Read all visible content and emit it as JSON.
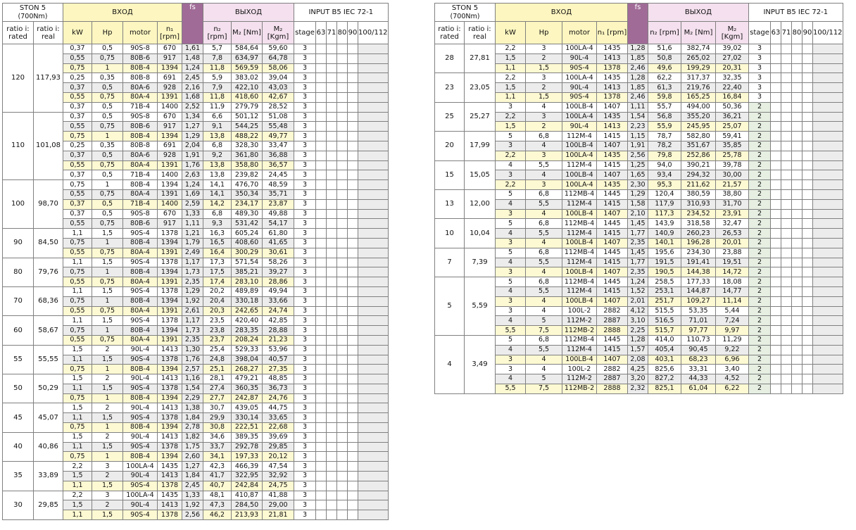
{
  "header": {
    "title": "STON 5",
    "torque": "(700Nm)",
    "input_group": "ВХОД",
    "output_group": "ВЫХОД",
    "fs_label": "fs",
    "input_b5": "INPUT B5 IEC 72-1",
    "col_ratio_rated": "ratio i: rated",
    "col_ratio_real": "ratio i: real",
    "col_kw": "kW",
    "col_hp": "Hp",
    "col_motor": "motor",
    "col_n1": "n₁ [rpm]",
    "col_n2": "n₂ [rpm]",
    "col_m2_nm": "M₂ [Nm]",
    "col_m2_kgm": "M₂ [Kgm]",
    "col_stage": "stage",
    "iec_sizes": [
      "63",
      "71",
      "80",
      "90",
      "100/112"
    ]
  },
  "left_table": [
    {
      "rated": "120",
      "real": "117,93",
      "rows": [
        [
          "0,37",
          "0,5",
          "90S-8",
          "670",
          "1,61",
          "5,7",
          "584,64",
          "59,60",
          "3"
        ],
        [
          "0,55",
          "0,75",
          "80B-6",
          "917",
          "1,48",
          "7,8",
          "634,97",
          "64,78",
          "3"
        ],
        [
          "0,75",
          "1",
          "80B-4",
          "1394",
          "1,24",
          "11,8",
          "569,59",
          "58,06",
          "3"
        ],
        [
          "0,25",
          "0,35",
          "80B-8",
          "691",
          "2,45",
          "5,9",
          "383,02",
          "39,04",
          "3"
        ],
        [
          "0,37",
          "0,5",
          "80A-6",
          "928",
          "2,16",
          "7,9",
          "422,10",
          "43,03",
          "3"
        ],
        [
          "0,55",
          "0,75",
          "80A-4",
          "1391",
          "1,68",
          "11,8",
          "418,60",
          "42,67",
          "3"
        ],
        [
          "0,37",
          "0,5",
          "71B-4",
          "1400",
          "2,52",
          "11,9",
          "279,79",
          "28,52",
          "3"
        ]
      ]
    },
    {
      "rated": "110",
      "real": "101,08",
      "rows": [
        [
          "0,37",
          "0,5",
          "90S-8",
          "670",
          "1,34",
          "6,6",
          "501,12",
          "51,08",
          "3"
        ],
        [
          "0,55",
          "0,75",
          "80B-6",
          "917",
          "1,27",
          "9,1",
          "544,25",
          "55,48",
          "3"
        ],
        [
          "0,75",
          "1",
          "80B-4",
          "1394",
          "1,29",
          "13,8",
          "488,22",
          "49,77",
          "3"
        ],
        [
          "0,25",
          "0,35",
          "80B-8",
          "691",
          "2,04",
          "6,8",
          "328,30",
          "33,47",
          "3"
        ],
        [
          "0,37",
          "0,5",
          "80A-6",
          "928",
          "1,91",
          "9,2",
          "361,80",
          "36,88",
          "3"
        ],
        [
          "0,55",
          "0,75",
          "80A-4",
          "1391",
          "1,76",
          "13,8",
          "358,80",
          "36,57",
          "3"
        ],
        [
          "0,37",
          "0,5",
          "71B-4",
          "1400",
          "2,63",
          "13,8",
          "239,82",
          "24,45",
          "3"
        ]
      ]
    },
    {
      "rated": "100",
      "real": "98,70",
      "rows": [
        [
          "0,75",
          "1",
          "80B-4",
          "1394",
          "1,24",
          "14,1",
          "476,70",
          "48,59",
          "3"
        ],
        [
          "0,55",
          "0,75",
          "80A-4",
          "1391",
          "1,69",
          "14,1",
          "350,34",
          "35,71",
          "3"
        ],
        [
          "0,37",
          "0,5",
          "71B-4",
          "1400",
          "2,59",
          "14,2",
          "234,17",
          "23,87",
          "3"
        ],
        [
          "0,37",
          "0,5",
          "90S-8",
          "670",
          "1,33",
          "6,8",
          "489,30",
          "49,88",
          "3"
        ],
        [
          "0,55",
          "0,75",
          "80B-6",
          "917",
          "1,11",
          "9,3",
          "531,42",
          "54,17",
          "3"
        ]
      ]
    },
    {
      "rated": "90",
      "real": "84,50",
      "rows": [
        [
          "1,1",
          "1,5",
          "90S-4",
          "1378",
          "1,21",
          "16,3",
          "605,24",
          "61,80",
          "3"
        ],
        [
          "0,75",
          "1",
          "80B-4",
          "1394",
          "1,79",
          "16,5",
          "408,60",
          "41,65",
          "3"
        ],
        [
          "0,55",
          "0,75",
          "80A-4",
          "1391",
          "2,49",
          "16,4",
          "300,29",
          "30,61",
          "3"
        ]
      ]
    },
    {
      "rated": "80",
      "real": "79,76",
      "rows": [
        [
          "1,1",
          "1,5",
          "90S-4",
          "1378",
          "1,17",
          "17,3",
          "571,54",
          "58,26",
          "3"
        ],
        [
          "0,75",
          "1",
          "80B-4",
          "1394",
          "1,73",
          "17,5",
          "385,21",
          "39,27",
          "3"
        ],
        [
          "0,55",
          "0,75",
          "80A-4",
          "1391",
          "2,35",
          "17,4",
          "283,10",
          "28,86",
          "3"
        ]
      ]
    },
    {
      "rated": "70",
      "real": "68,36",
      "rows": [
        [
          "1,1",
          "1,5",
          "90S-4",
          "1378",
          "1,29",
          "20,2",
          "489,89",
          "49,94",
          "3"
        ],
        [
          "0,75",
          "1",
          "80B-4",
          "1394",
          "1,92",
          "20,4",
          "330,18",
          "33,66",
          "3"
        ],
        [
          "0,55",
          "0,75",
          "80A-4",
          "1391",
          "2,61",
          "20,3",
          "242,65",
          "24,74",
          "3"
        ]
      ]
    },
    {
      "rated": "60",
      "real": "58,67",
      "rows": [
        [
          "1,1",
          "1,5",
          "90S-4",
          "1378",
          "1,17",
          "23,5",
          "420,40",
          "42,85",
          "3"
        ],
        [
          "0,75",
          "1",
          "80B-4",
          "1394",
          "1,73",
          "23,8",
          "283,35",
          "28,88",
          "3"
        ],
        [
          "0,55",
          "0,75",
          "80A-4",
          "1391",
          "2,35",
          "23,7",
          "208,24",
          "21,23",
          "3"
        ]
      ]
    },
    {
      "rated": "55",
      "real": "55,55",
      "rows": [
        [
          "1,5",
          "2",
          "90L-4",
          "1413",
          "1,30",
          "25,4",
          "529,33",
          "53,96",
          "3"
        ],
        [
          "1,1",
          "1,5",
          "90S-4",
          "1378",
          "1,76",
          "24,8",
          "398,04",
          "40,57",
          "3"
        ],
        [
          "0,75",
          "1",
          "80B-4",
          "1394",
          "2,57",
          "25,1",
          "268,27",
          "27,35",
          "3"
        ]
      ]
    },
    {
      "rated": "50",
      "real": "50,29",
      "rows": [
        [
          "1,5",
          "2",
          "90L-4",
          "1413",
          "1,16",
          "28,1",
          "479,21",
          "48,85",
          "3"
        ],
        [
          "1,1",
          "1,5",
          "90S-4",
          "1378",
          "1,54",
          "27,4",
          "360,35",
          "36,73",
          "3"
        ],
        [
          "0,75",
          "1",
          "80B-4",
          "1394",
          "2,29",
          "27,7",
          "242,87",
          "24,76",
          "3"
        ]
      ]
    },
    {
      "rated": "45",
      "real": "45,07",
      "rows": [
        [
          "1,5",
          "2",
          "90L-4",
          "1413",
          "1,38",
          "30,7",
          "439,05",
          "44,75",
          "3"
        ],
        [
          "1,1",
          "1,5",
          "90S-4",
          "1378",
          "1,84",
          "29,9",
          "330,14",
          "33,65",
          "3"
        ],
        [
          "0,75",
          "1",
          "80B-4",
          "1394",
          "2,78",
          "30,8",
          "222,51",
          "22,68",
          "3"
        ]
      ]
    },
    {
      "rated": "40",
      "real": "40,86",
      "rows": [
        [
          "1,5",
          "2",
          "90L-4",
          "1413",
          "1,82",
          "34,6",
          "389,35",
          "39,69",
          "3"
        ],
        [
          "1,1",
          "1,5",
          "90S-4",
          "1378",
          "1,75",
          "33,7",
          "292,78",
          "29,85",
          "3"
        ],
        [
          "0,75",
          "1",
          "80B-4",
          "1394",
          "2,60",
          "34,1",
          "197,33",
          "20,12",
          "3"
        ]
      ]
    },
    {
      "rated": "35",
      "real": "33,89",
      "rows": [
        [
          "2,2",
          "3",
          "100LA-4",
          "1435",
          "1,27",
          "42,3",
          "466,39",
          "47,54",
          "3"
        ],
        [
          "1,5",
          "2",
          "90L-4",
          "1413",
          "1,84",
          "41,7",
          "322,95",
          "32,92",
          "3"
        ],
        [
          "1,1",
          "1,5",
          "90S-4",
          "1378",
          "2,45",
          "40,7",
          "242,84",
          "24,75",
          "3"
        ]
      ]
    },
    {
      "rated": "30",
      "real": "29,85",
      "rows": [
        [
          "2,2",
          "3",
          "100LA-4",
          "1435",
          "1,33",
          "48,1",
          "410,87",
          "41,88",
          "3"
        ],
        [
          "1,5",
          "2",
          "90L-4",
          "1413",
          "1,92",
          "47,3",
          "284,50",
          "29,00",
          "3"
        ],
        [
          "1,1",
          "1,5",
          "90S-4",
          "1378",
          "2,56",
          "46,2",
          "213,93",
          "21,81",
          "3"
        ]
      ]
    }
  ],
  "right_table": [
    {
      "rated": "28",
      "real": "27,81",
      "rows": [
        [
          "2,2",
          "3",
          "100LA-4",
          "1435",
          "1,28",
          "51,6",
          "382,74",
          "39,02",
          "3"
        ],
        [
          "1,5",
          "2",
          "90L-4",
          "1413",
          "1,85",
          "50,8",
          "265,02",
          "27,02",
          "3"
        ],
        [
          "1,1",
          "1,5",
          "90S-4",
          "1378",
          "2,46",
          "49,6",
          "199,29",
          "20,31",
          "3"
        ]
      ]
    },
    {
      "rated": "23",
      "real": "23,05",
      "rows": [
        [
          "2,2",
          "3",
          "100LA-4",
          "1435",
          "1,28",
          "62,2",
          "317,37",
          "32,35",
          "3"
        ],
        [
          "1,5",
          "2",
          "90L-4",
          "1413",
          "1,85",
          "61,3",
          "219,76",
          "22,40",
          "3"
        ],
        [
          "1,1",
          "1,5",
          "90S-4",
          "1378",
          "2,46",
          "59,8",
          "165,25",
          "16,84",
          "3"
        ]
      ]
    },
    {
      "rated": "25",
      "real": "25,27",
      "rows": [
        [
          "3",
          "4",
          "100LB-4",
          "1407",
          "1,11",
          "55,7",
          "494,00",
          "50,36",
          "2"
        ],
        [
          "2,2",
          "3",
          "100LA-4",
          "1435",
          "1,54",
          "56,8",
          "355,20",
          "36,21",
          "2"
        ],
        [
          "1,5",
          "2",
          "90L-4",
          "1413",
          "2,23",
          "55,9",
          "245,95",
          "25,07",
          "2"
        ]
      ]
    },
    {
      "rated": "20",
      "real": "17,99",
      "rows": [
        [
          "5",
          "6,8",
          "112M-4",
          "1415",
          "1,15",
          "78,7",
          "582,80",
          "59,41",
          "2"
        ],
        [
          "3",
          "4",
          "100LB-4",
          "1407",
          "1,91",
          "78,2",
          "351,67",
          "35,85",
          "2"
        ],
        [
          "2,2",
          "3",
          "100LA-4",
          "1435",
          "2,56",
          "79,8",
          "252,86",
          "25,78",
          "2"
        ]
      ]
    },
    {
      "rated": "15",
      "real": "15,05",
      "rows": [
        [
          "4",
          "5,5",
          "112M-4",
          "1415",
          "1,25",
          "94,0",
          "390,21",
          "39,78",
          "2"
        ],
        [
          "3",
          "4",
          "100LB-4",
          "1407",
          "1,65",
          "93,4",
          "294,32",
          "30,00",
          "2"
        ],
        [
          "2,2",
          "3",
          "100LA-4",
          "1435",
          "2,30",
          "95,3",
          "211,62",
          "21,57",
          "2"
        ]
      ]
    },
    {
      "rated": "13",
      "real": "12,00",
      "rows": [
        [
          "5",
          "6,8",
          "112MB-4",
          "1445",
          "1,29",
          "120,4",
          "380,59",
          "38,80",
          "2"
        ],
        [
          "4",
          "5,5",
          "112M-4",
          "1415",
          "1,58",
          "117,9",
          "310,93",
          "31,70",
          "2"
        ],
        [
          "3",
          "4",
          "100LB-4",
          "1407",
          "2,10",
          "117,3",
          "234,52",
          "23,91",
          "2"
        ]
      ]
    },
    {
      "rated": "10",
      "real": "10,04",
      "rows": [
        [
          "5",
          "6,8",
          "112MB-4",
          "1445",
          "1,45",
          "143,9",
          "318,58",
          "32,47",
          "2"
        ],
        [
          "4",
          "5,5",
          "112M-4",
          "1415",
          "1,77",
          "140,9",
          "260,23",
          "26,53",
          "2"
        ],
        [
          "3",
          "4",
          "100LB-4",
          "1407",
          "2,35",
          "140,1",
          "196,28",
          "20,01",
          "2"
        ]
      ]
    },
    {
      "rated": "7",
      "real": "7,39",
      "rows": [
        [
          "5",
          "6,8",
          "112MB-4",
          "1445",
          "1,45",
          "195,6",
          "234,30",
          "23,88",
          "2"
        ],
        [
          "4",
          "5,5",
          "112M-4",
          "1415",
          "1,77",
          "191,5",
          "191,41",
          "19,51",
          "2"
        ],
        [
          "3",
          "4",
          "100LB-4",
          "1407",
          "2,35",
          "190,5",
          "144,38",
          "14,72",
          "2"
        ]
      ]
    },
    {
      "rated": "5",
      "real": "5,59",
      "rows": [
        [
          "5",
          "6,8",
          "112MB-4",
          "1445",
          "1,24",
          "258,5",
          "177,33",
          "18,08",
          "2"
        ],
        [
          "4",
          "5,5",
          "112M-4",
          "1415",
          "1,52",
          "253,1",
          "144,87",
          "14,77",
          "2"
        ],
        [
          "3",
          "4",
          "100LB-4",
          "1407",
          "2,01",
          "251,7",
          "109,27",
          "11,14",
          "2"
        ],
        [
          "3",
          "4",
          "100L-2",
          "2882",
          "4,12",
          "515,5",
          "53,35",
          "5,44",
          "2"
        ],
        [
          "4",
          "5",
          "112M-2",
          "2887",
          "3,10",
          "516,5",
          "71,01",
          "7,24",
          "2"
        ],
        [
          "5,5",
          "7,5",
          "112MB-2",
          "2888",
          "2,25",
          "515,7",
          "97,77",
          "9,97",
          "2"
        ]
      ]
    },
    {
      "rated": "4",
      "real": "3,49",
      "rows": [
        [
          "5",
          "6,8",
          "112MB-4",
          "1445",
          "1,28",
          "414,0",
          "110,73",
          "11,29",
          "2"
        ],
        [
          "4",
          "5,5",
          "112M-4",
          "1415",
          "1,57",
          "405,4",
          "90,45",
          "9,22",
          "2"
        ],
        [
          "3",
          "4",
          "100LB-4",
          "1407",
          "2,08",
          "403,1",
          "68,23",
          "6,96",
          "2"
        ],
        [
          "3",
          "4",
          "100L-2",
          "2882",
          "4,25",
          "825,6",
          "33,31",
          "3,40",
          "2"
        ],
        [
          "4",
          "5",
          "112M-2",
          "2887",
          "3,20",
          "827,2",
          "44,33",
          "4,52",
          "2"
        ],
        [
          "5,5",
          "7,5",
          "112MB-2",
          "2888",
          "2,32",
          "825,1",
          "61,04",
          "6,22",
          "2"
        ]
      ]
    }
  ]
}
